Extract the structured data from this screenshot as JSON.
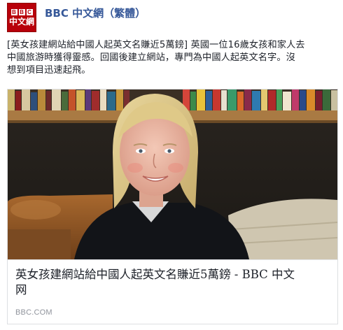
{
  "page": {
    "name": "BBC 中文網（繁體）",
    "avatar": {
      "logo_letters": [
        "B",
        "B",
        "C"
      ],
      "label": "中文網"
    }
  },
  "post": {
    "text_lines": [
      "[英女孩建網站給中國人起英文名賺近5萬鎊] 英國一位16歲女孩和家人去",
      "中國旅游時獲得靈感。回國後建立網站，專門為中國人起英文名字。沒",
      "想到項目迅速起飛。"
    ]
  },
  "link_card": {
    "title_lines": [
      "英女孩建網站給中國人起英文名賺近5萬鎊 - BBC 中文",
      "网"
    ],
    "domain": "BBC.COM"
  },
  "colors": {
    "brand_red": "#b8000a",
    "page_name_blue": "#365899",
    "domain_gray": "#90949c"
  }
}
